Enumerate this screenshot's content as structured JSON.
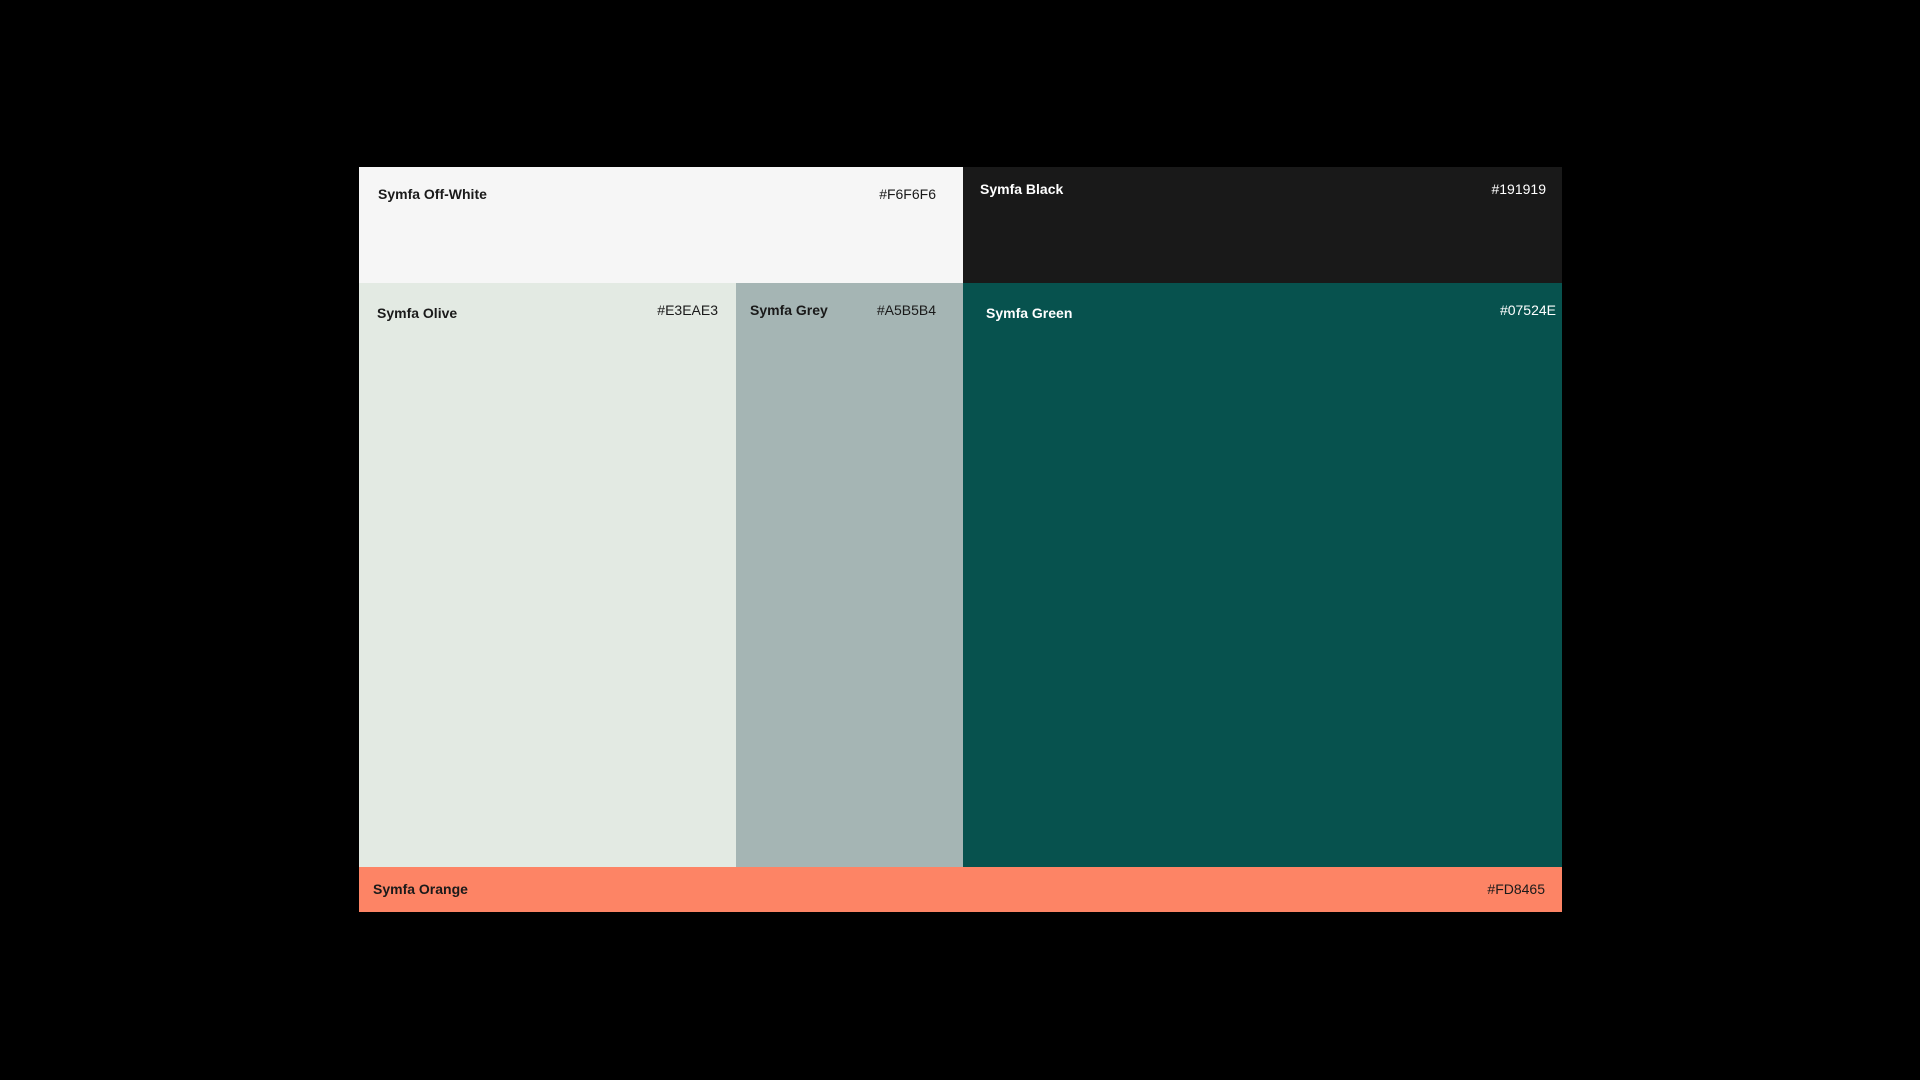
{
  "swatches": {
    "off_white": {
      "name": "Symfa Off-White",
      "hex": "#F6F6F6",
      "text_color": "#1a1a1a"
    },
    "black": {
      "name": "Symfa Black",
      "hex": "#191919",
      "text_color": "#ffffff"
    },
    "olive": {
      "name": "Symfa Olive",
      "hex": "#E3EAE3",
      "text_color": "#1a1a1a"
    },
    "grey": {
      "name": "Symfa Grey",
      "hex": "#A5B5B4",
      "text_color": "#1a1a1a"
    },
    "green": {
      "name": "Symfa Green",
      "hex": "#07524E",
      "text_color": "#ffffff"
    },
    "orange": {
      "name": "Symfa Orange",
      "hex": "#FD8465",
      "text_color": "#1a1a1a"
    }
  }
}
